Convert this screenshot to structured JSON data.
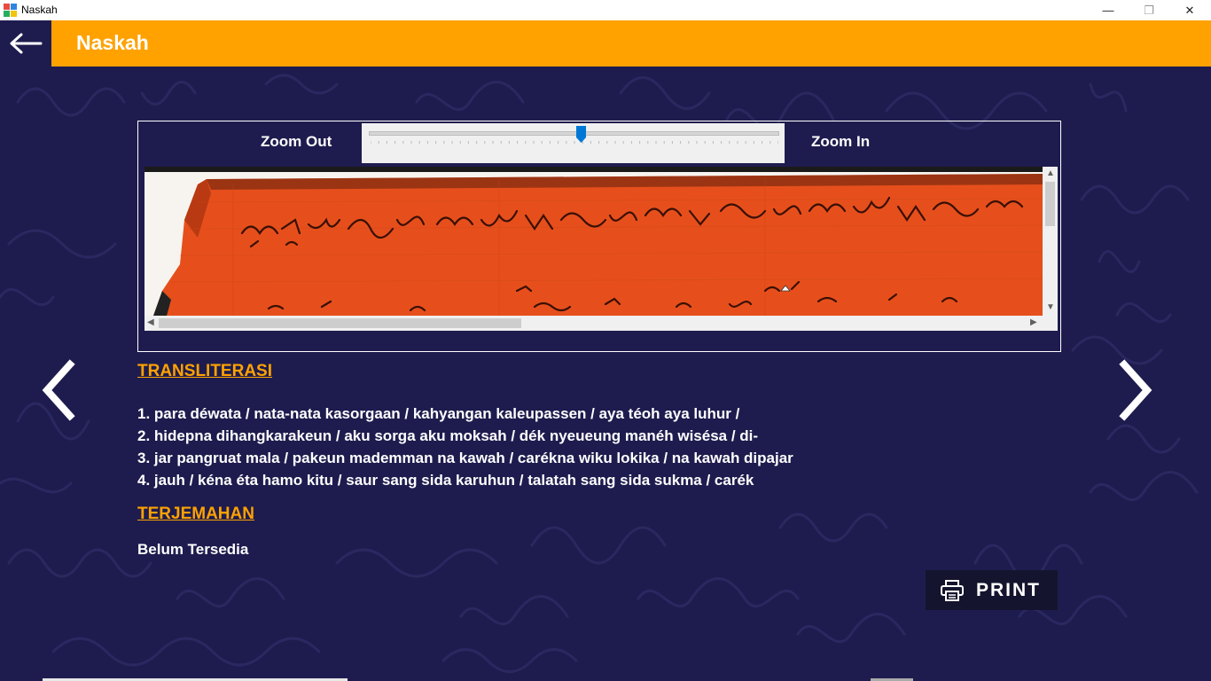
{
  "window": {
    "title": "Naskah",
    "minimize_glyph": "—",
    "maximize_glyph": "❐",
    "close_glyph": "✕"
  },
  "header": {
    "title": "Naskah",
    "back_icon": "arrow-left-icon"
  },
  "viewer": {
    "zoom_out_label": "Zoom Out",
    "zoom_in_label": "Zoom In",
    "zoom_level": 0.52
  },
  "transliterasi": {
    "heading": "TRANSLITERASI",
    "lines": [
      "1. para déwata / nata-nata kasorgaan / kahyangan kaleupassen / aya téoh aya luhur /",
      "2. hidepna dihangkarakeun / aku sorga aku moksah / dék nyeueung manéh wisésa / di-",
      "3. jar pangruat mala / pakeun mademman na kawah / carékna wiku lokika / na kawah dipajar",
      "4. jauh / kéna éta hamo kitu / saur sang sida karuhun / talatah sang sida sukma / carék"
    ]
  },
  "terjemahan": {
    "heading": "TERJEMAHAN",
    "text": "Belum Tersedia"
  },
  "actions": {
    "print_label": "PRINT",
    "print_icon": "printer-icon",
    "prev_icon": "chevron-left-icon",
    "next_icon": "chevron-right-icon"
  },
  "colors": {
    "accent": "#ffa200",
    "background": "#1e1c4e",
    "manuscript": "#e8501a"
  }
}
